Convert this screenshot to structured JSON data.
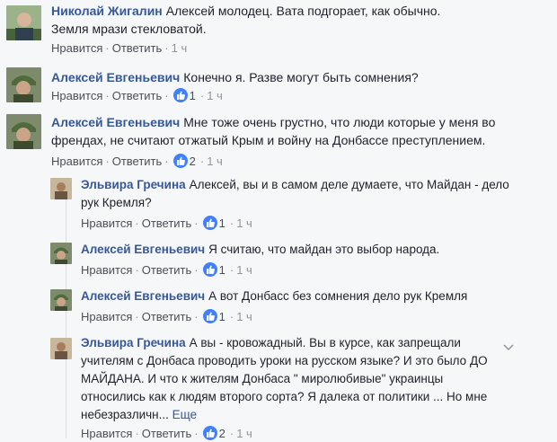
{
  "comments": [
    {
      "author": "Николай Жигалин",
      "text": "Алексей молодец. Вата подгорает, как обычно. Земля мрази стекловатой.",
      "like_label": "Нравится",
      "reply_label": "Ответить",
      "likes": "",
      "time": "1 ч"
    },
    {
      "author": "Алексей Евгеньевич",
      "text": "Конечно я. Разве могут быть сомнения?",
      "like_label": "Нравится",
      "reply_label": "Ответить",
      "likes": "1",
      "time": "1 ч"
    },
    {
      "author": "Алексей Евгеньевич",
      "text": "Мне тоже очень грустно, что люди которые у меня во френдах, не считают отжатый Крым и войну на Донбассе преступлением.",
      "like_label": "Нравится",
      "reply_label": "Ответить",
      "likes": "2",
      "time": "1 ч"
    }
  ],
  "replies": [
    {
      "author": "Эльвира Гречина",
      "text": "Алексей, вы и в самом деле думаете, что Майдан - дело рук Кремля?",
      "like_label": "Нравится",
      "reply_label": "Ответить",
      "likes": "1",
      "time": "1 ч"
    },
    {
      "author": "Алексей Евгеньевич",
      "text": "Я считаю, что майдан это выбор народа.",
      "like_label": "Нравится",
      "reply_label": "Ответить",
      "likes": "1",
      "time": "1 ч"
    },
    {
      "author": "Алексей Евгеньевич",
      "text": "А вот Донбасс без сомнения дело рук Кремля",
      "like_label": "Нравится",
      "reply_label": "Ответить",
      "likes": "1",
      "time": "1 ч"
    },
    {
      "author": "Эльвира Гречина",
      "text": "А вы - кровожадный. Вы в курсе, как запрещали учителям с Донбаса проводить уроки на русском языке? И это было ДО МАЙДАНА. И что к жителям Донбаса \" миролюбивые\" украинцы относились как к людям второго сорта? Я далека от политики ... Но мне небезразличн...",
      "more_label": "Еще",
      "like_label": "Нравится",
      "reply_label": "Ответить",
      "likes": "2",
      "time": "1 ч"
    }
  ],
  "icons": {
    "like": "thumbs-up-icon",
    "menu": "chevron-down-icon"
  },
  "colors": {
    "author": "#365899",
    "like_badge": "#4080ff",
    "meta": "#90949c"
  }
}
